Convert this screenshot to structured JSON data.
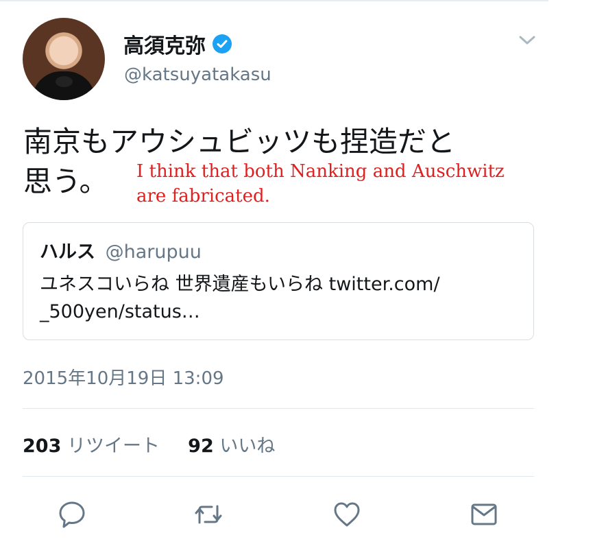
{
  "tweet": {
    "author_name": "高須克弥",
    "handle": "@katsuyatakasu",
    "text_line1": "南京もアウシュビッツも捏造だと",
    "text_line2": "思う。",
    "timestamp": "2015年10月19日 13:09",
    "retweet_count": "203",
    "retweet_label": "リツイート",
    "like_count": "92",
    "like_label": "いいね"
  },
  "translation": {
    "line1": "I think that both Nanking and Auschwitz",
    "line2": "are fabricated."
  },
  "quoted_tweet": {
    "author_name": "ハルス",
    "handle": "@harupuu",
    "text_line1": "ユネスコいらね 世界遺産もいらね twitter.com/",
    "text_line2": "_500yen/status…"
  },
  "icons": {
    "verified": "verified-badge-icon",
    "menu": "chevron-down-icon",
    "reply": "reply-icon",
    "retweet": "retweet-icon",
    "like": "heart-icon",
    "message": "envelope-icon"
  },
  "colors": {
    "accent": "#1da1f2",
    "muted": "#657786",
    "translation": "#e0201f"
  }
}
